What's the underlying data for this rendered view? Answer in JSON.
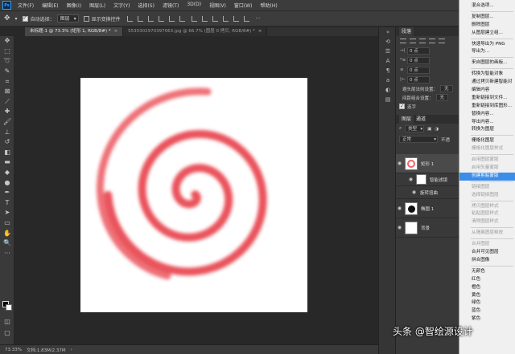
{
  "menubar": {
    "logo": "Ps",
    "items": [
      "文件(F)",
      "编辑(E)",
      "图像(I)",
      "图层(L)",
      "文字(Y)",
      "选择(S)",
      "滤镜(T)",
      "3D(D)",
      "视图(V)",
      "窗口(W)",
      "帮助(H)"
    ]
  },
  "options": {
    "auto_select_label": "自动选择：",
    "auto_select_value": "图层",
    "show_transform_label": "显示变换控件"
  },
  "tabs": [
    {
      "label": "未标题-1 @ 73.3% (矩形 1, RGB/8#) *",
      "active": true
    },
    {
      "label": "5530302970397063.jpg @ 66.7% (图层 0 拷贝, RGB/8#) *",
      "active": false
    }
  ],
  "status": {
    "zoom": "73.33%",
    "doc": "文档:1.83M/2.37M"
  },
  "paragraph_panel": {
    "tab": "段落",
    "fields": [
      {
        "label": "→|",
        "value": "0 点"
      },
      {
        "label": "*≡",
        "value": "0 点"
      },
      {
        "label": "≡",
        "value": "0 点"
      },
      {
        "label": "|←",
        "value": "0 点"
      }
    ],
    "avoid_label": "避头尾法则设置：",
    "avoid_value": "无",
    "spacing_label": "间距组合设置：",
    "spacing_value": "无",
    "hyphen_label": "连字"
  },
  "layers_panel": {
    "tabs": [
      "图层",
      "通道"
    ],
    "kind_label": "类型",
    "blend_mode": "正常",
    "opacity_label": "不透",
    "layers": [
      {
        "name": "矩形 1",
        "type": "shape",
        "selected": true
      },
      {
        "name": "智能滤镜",
        "type": "filter"
      },
      {
        "name": "旋转扭曲",
        "type": "subfilter"
      },
      {
        "name": "椭圆 1",
        "type": "ellipse"
      },
      {
        "name": "背景",
        "type": "background"
      }
    ]
  },
  "context_menu": {
    "items": [
      {
        "label": "混合选项...",
        "enabled": true
      },
      {
        "sep": true
      },
      {
        "label": "复制图层...",
        "enabled": true
      },
      {
        "label": "删除图层",
        "enabled": true
      },
      {
        "label": "从图层建立组...",
        "enabled": true
      },
      {
        "sep": true
      },
      {
        "label": "快速导出为 PNG",
        "enabled": true
      },
      {
        "label": "导出为...",
        "enabled": true
      },
      {
        "sep": true
      },
      {
        "label": "来自图层的画板...",
        "enabled": true
      },
      {
        "sep": true
      },
      {
        "label": "转换为智能对象",
        "enabled": true
      },
      {
        "label": "通过拷贝新建智能对",
        "enabled": true
      },
      {
        "label": "编辑内容",
        "enabled": true
      },
      {
        "label": "重新链接到文件...",
        "enabled": true
      },
      {
        "label": "重新链接到库图形...",
        "enabled": true
      },
      {
        "label": "替换内容...",
        "enabled": true
      },
      {
        "label": "导出内容...",
        "enabled": true
      },
      {
        "label": "转换为图层",
        "enabled": true
      },
      {
        "sep": true
      },
      {
        "label": "栅格化图层",
        "enabled": true
      },
      {
        "label": "栅格化图层样式",
        "enabled": false
      },
      {
        "sep": true
      },
      {
        "label": "启用图层蒙版",
        "enabled": false
      },
      {
        "label": "启用矢量蒙版",
        "enabled": false
      },
      {
        "label": "创建剪贴蒙版",
        "enabled": true,
        "highlighted": true
      },
      {
        "sep": true
      },
      {
        "label": "链接图层",
        "enabled": false
      },
      {
        "label": "选择链接图层",
        "enabled": false
      },
      {
        "sep": true
      },
      {
        "label": "拷贝图层样式",
        "enabled": false
      },
      {
        "label": "粘贴图层样式",
        "enabled": false
      },
      {
        "label": "清除图层样式",
        "enabled": false
      },
      {
        "sep": true
      },
      {
        "label": "从隔离图层释放",
        "enabled": false
      },
      {
        "sep": true
      },
      {
        "label": "合并图层",
        "enabled": false
      },
      {
        "label": "合并可见图层",
        "enabled": true
      },
      {
        "label": "拼合图像",
        "enabled": true
      },
      {
        "sep": true
      },
      {
        "label": "无颜色",
        "enabled": true
      },
      {
        "label": "红色",
        "enabled": true
      },
      {
        "label": "橙色",
        "enabled": true
      },
      {
        "label": "黄色",
        "enabled": true
      },
      {
        "label": "绿色",
        "enabled": true
      },
      {
        "label": "蓝色",
        "enabled": true
      },
      {
        "label": "紫色",
        "enabled": true
      }
    ]
  },
  "watermark": "头条 @智绘源设计",
  "colors": {
    "swirl_red": "#e8414a",
    "highlight": "#3c8de8"
  }
}
